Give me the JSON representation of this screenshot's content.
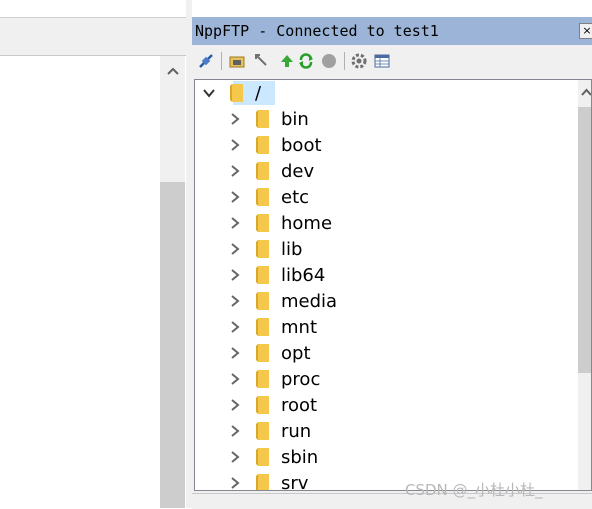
{
  "ftp_panel": {
    "title": "NppFTP - Connected to test1",
    "close_label": "×",
    "toolbar": [
      "connect-icon",
      "open-cache-icon",
      "download-icon",
      "upload-icon",
      "refresh-icon",
      "abort-icon",
      "settings-icon",
      "messages-icon"
    ],
    "tree": {
      "root": "/",
      "items": [
        "bin",
        "boot",
        "dev",
        "etc",
        "home",
        "lib",
        "lib64",
        "media",
        "mnt",
        "opt",
        "proc",
        "root",
        "run",
        "sbin",
        "srv"
      ]
    }
  },
  "watermark": "CSDN @_小杜小杜_",
  "colors": {
    "title_bar": "#9cb4d8",
    "selection": "#cce8ff",
    "folder": "#f5c84c"
  }
}
